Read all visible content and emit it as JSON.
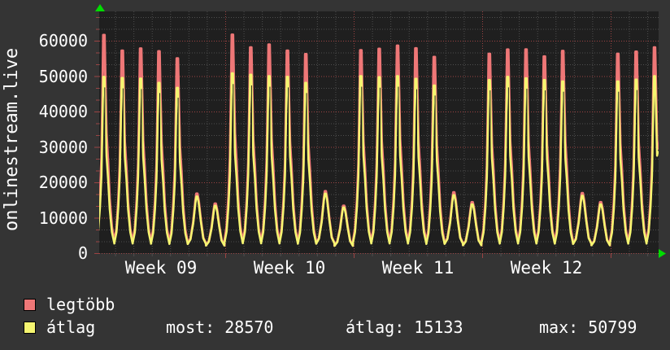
{
  "graph": {
    "vertical_title": "onlinestream.live",
    "legend": {
      "series1_label": "legtöbb",
      "series1_color": "#ee7777",
      "series2_label": "átlag",
      "series2_color": "#f5f570"
    },
    "stats": {
      "most": "most: 28570",
      "atlag": "átlag: 15133",
      "max": "max: 50799"
    }
  },
  "chart_data": {
    "type": "line",
    "title": "onlinestream.live",
    "x_unit": "day",
    "x_tick_labels": [
      "Week 09",
      "Week 10",
      "Week 11",
      "Week 12"
    ],
    "y_ticks": [
      0,
      10000,
      20000,
      30000,
      40000,
      50000,
      60000
    ],
    "ylim": [
      0,
      68000
    ],
    "grid": {
      "minor_color": "#4e4e4e",
      "major_color": "#9c4343",
      "style": "dotted"
    },
    "legend_position": "bottom-left",
    "axis_arrow_color": "#00dd00",
    "plot_bg": "#1f1f1f",
    "valley_level": 2800,
    "end_value": 28570,
    "series": [
      {
        "name": "legtöbb",
        "color": "#ee7777",
        "daily_peaks": [
          61600,
          57200,
          57800,
          57000,
          55000,
          16800,
          14000,
          61700,
          58100,
          58900,
          57200,
          56200,
          17500,
          13400,
          57300,
          57700,
          58600,
          57850,
          55400,
          17200,
          14400,
          56300,
          57500,
          57550,
          55550,
          57100,
          16950,
          14400,
          56300,
          56900,
          58100
        ]
      },
      {
        "name": "átlag",
        "color": "#f5f570",
        "daily_peaks": [
          49800,
          49500,
          49300,
          48100,
          46700,
          16000,
          13400,
          50799,
          50400,
          50000,
          49800,
          48100,
          16800,
          12900,
          50000,
          49700,
          50000,
          49250,
          47350,
          16400,
          13800,
          48900,
          49800,
          49400,
          48900,
          48500,
          16200,
          13800,
          48500,
          49000,
          50000
        ]
      }
    ],
    "stats": {
      "most": 28570,
      "átlag": 15133,
      "max": 50799
    }
  }
}
